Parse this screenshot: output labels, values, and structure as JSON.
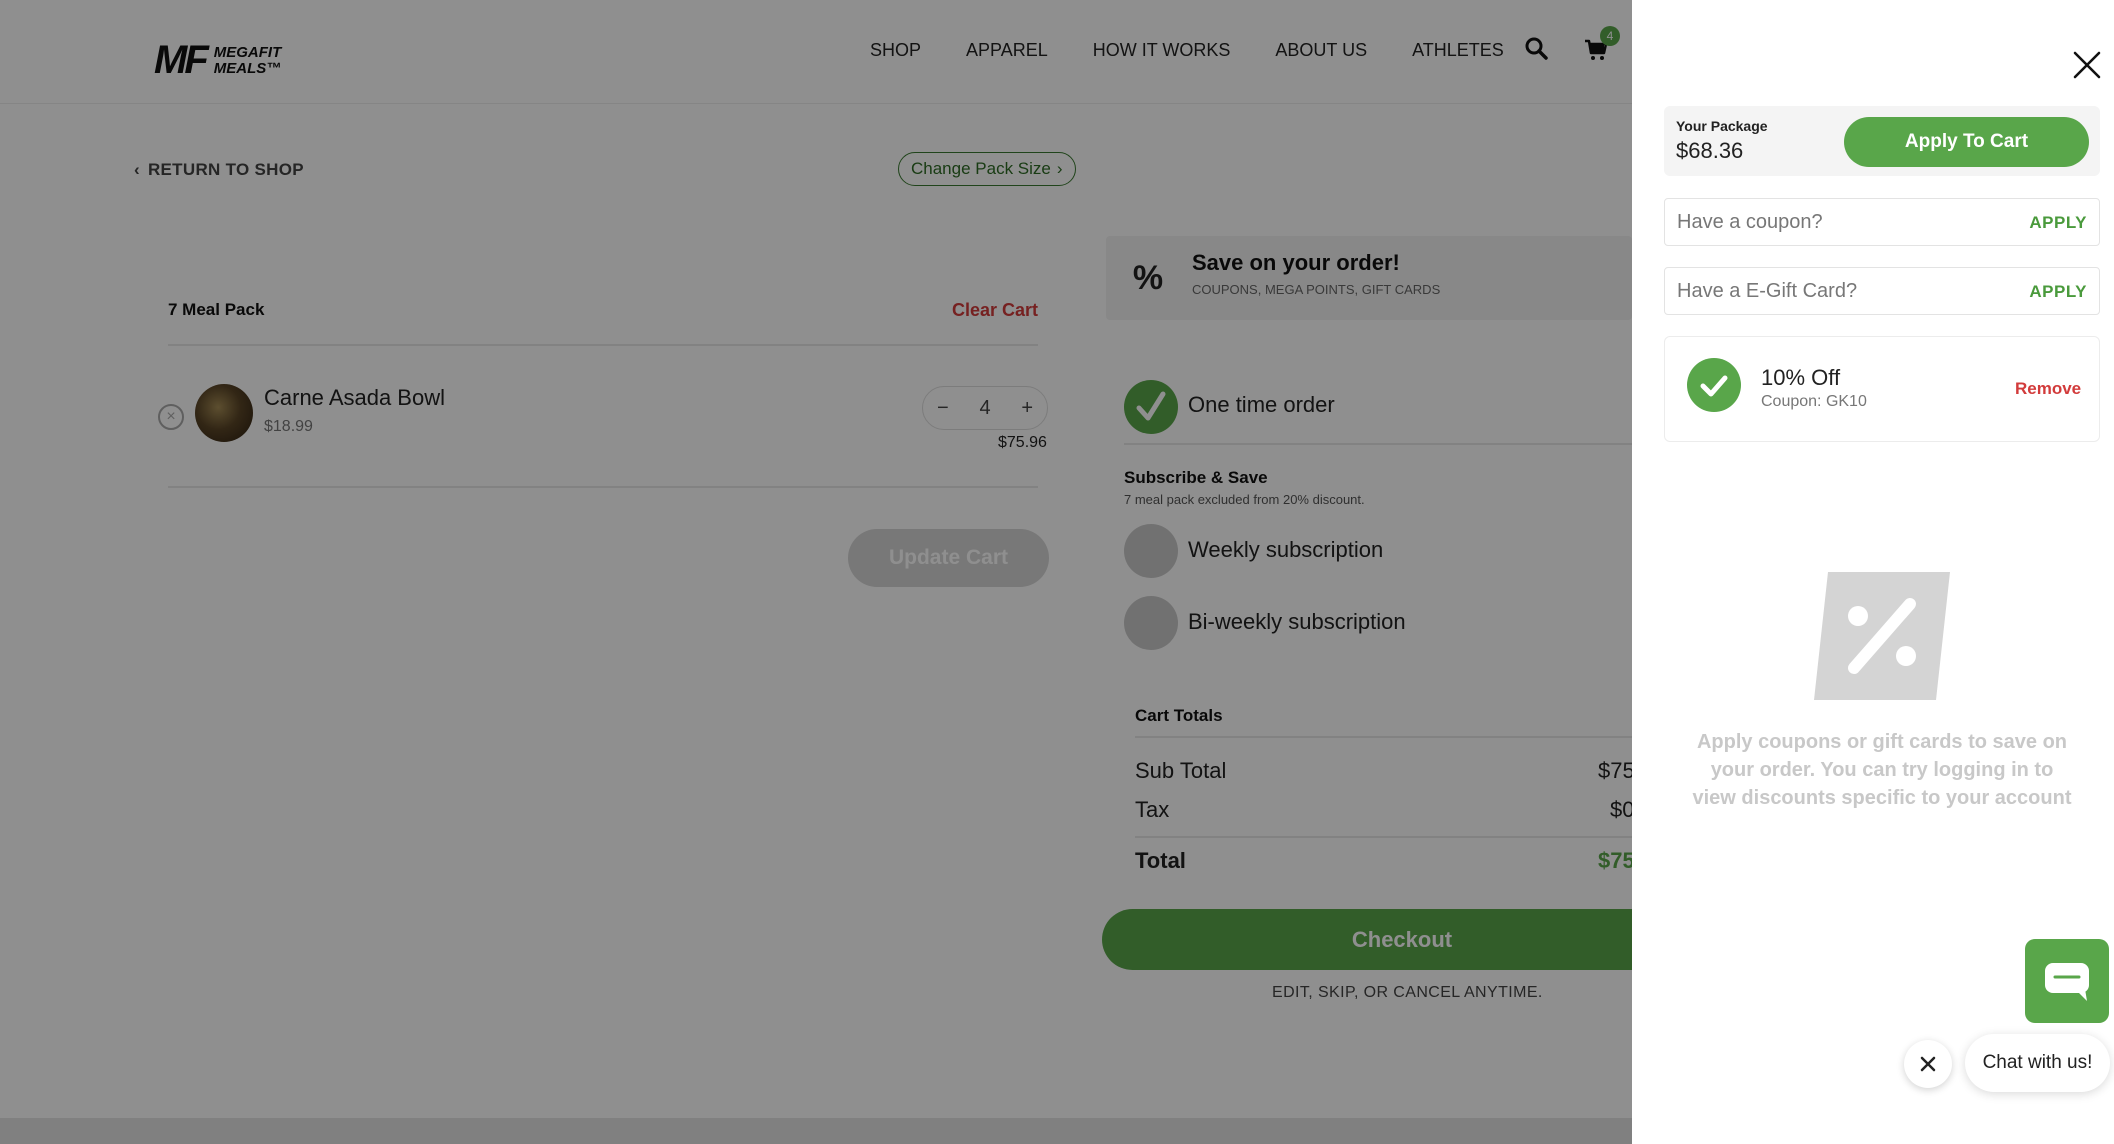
{
  "header": {
    "logo_mark": "MF",
    "logo_line1": "MEGAFIT",
    "logo_line2": "MEALS™",
    "nav": [
      "SHOP",
      "APPAREL",
      "HOW IT WORKS",
      "ABOUT US",
      "ATHLETES"
    ],
    "cart_count": "4"
  },
  "top_links": {
    "return": "RETURN TO SHOP",
    "change_pack": "Change Pack Size"
  },
  "cart": {
    "pack_title": "7 Meal Pack",
    "clear_label": "Clear Cart",
    "items": [
      {
        "name": "Carne Asada Bowl",
        "price": "$18.99",
        "qty": "4",
        "line_total": "$75.96"
      }
    ],
    "update_label": "Update Cart"
  },
  "savings": {
    "title": "Save on your order!",
    "subtitle": "COUPONS, MEGA POINTS, GIFT CARDS"
  },
  "order_options": {
    "one_time": "One time order",
    "subscribe_title": "Subscribe & Save",
    "subscribe_note": "7 meal pack excluded from 20% discount.",
    "weekly": "Weekly subscription",
    "biweekly": "Bi-weekly subscription"
  },
  "totals": {
    "title": "Cart Totals",
    "subtotal_label": "Sub Total",
    "subtotal_value": "$75",
    "tax_label": "Tax",
    "tax_value": "$0",
    "total_label": "Total",
    "total_value": "$75"
  },
  "checkout": {
    "label": "Checkout",
    "note": "EDIT, SKIP, OR CANCEL ANYTIME."
  },
  "drawer": {
    "package_label": "Your Package",
    "package_price": "$68.36",
    "apply_to_cart": "Apply To Cart",
    "coupon_placeholder": "Have a coupon?",
    "coupon_apply": "APPLY",
    "gift_placeholder": "Have a E-Gift Card?",
    "gift_apply": "APPLY",
    "applied_coupon": {
      "title": "10% Off",
      "code": "Coupon: GK10",
      "remove": "Remove"
    },
    "promo_text": "Apply coupons or gift cards to save on your order. You can try logging in to view discounts specific to your account"
  },
  "chat": {
    "label": "Chat with us!"
  },
  "colors": {
    "brand_green": "#59a64a",
    "danger_red": "#d23b3b"
  }
}
